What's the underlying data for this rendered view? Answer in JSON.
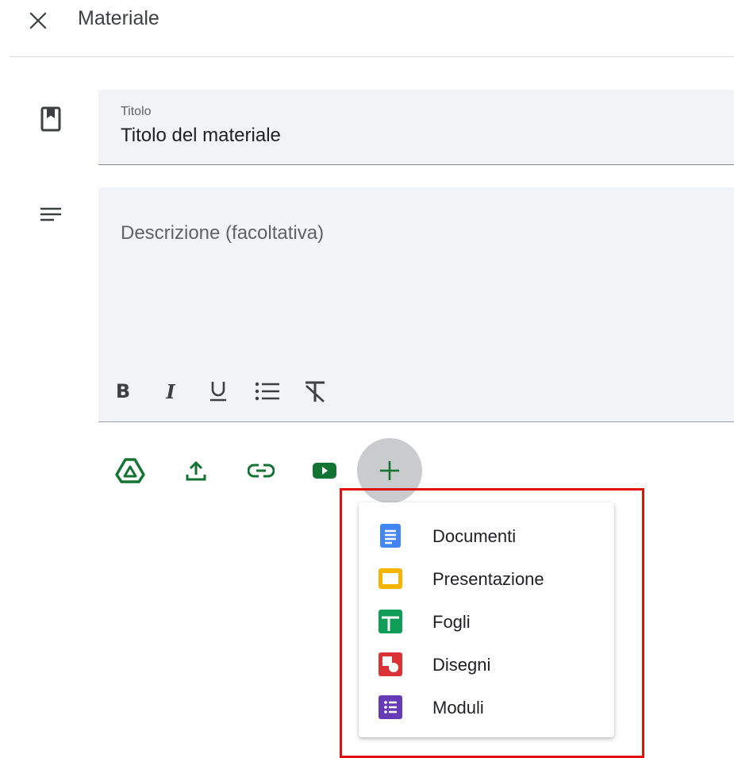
{
  "header": {
    "title": "Materiale",
    "close_icon": "close-icon"
  },
  "title_field": {
    "label": "Titolo",
    "value": "Titolo del materiale"
  },
  "description_field": {
    "placeholder": "Descrizione (facoltativa)"
  },
  "formatting": [
    "bold-icon",
    "italic-icon",
    "underline-icon",
    "bulleted-list-icon",
    "clear-formatting-icon"
  ],
  "attachments": [
    "google-drive-icon",
    "upload-icon",
    "link-icon",
    "youtube-icon",
    "add-icon"
  ],
  "create_menu": {
    "items": [
      {
        "label": "Documenti",
        "icon": "docs-icon",
        "color": "#4285f4"
      },
      {
        "label": "Presentazione",
        "icon": "slides-icon",
        "color": "#f4b400"
      },
      {
        "label": "Fogli",
        "icon": "sheets-icon",
        "color": "#0f9d58"
      },
      {
        "label": "Disegni",
        "icon": "drawings-icon",
        "color": "#db3236"
      },
      {
        "label": "Moduli",
        "icon": "forms-icon",
        "color": "#673ab7"
      }
    ]
  },
  "colors": {
    "accent": "#137333",
    "highlight": "#e01010",
    "field_bg": "#f1f3f4"
  }
}
